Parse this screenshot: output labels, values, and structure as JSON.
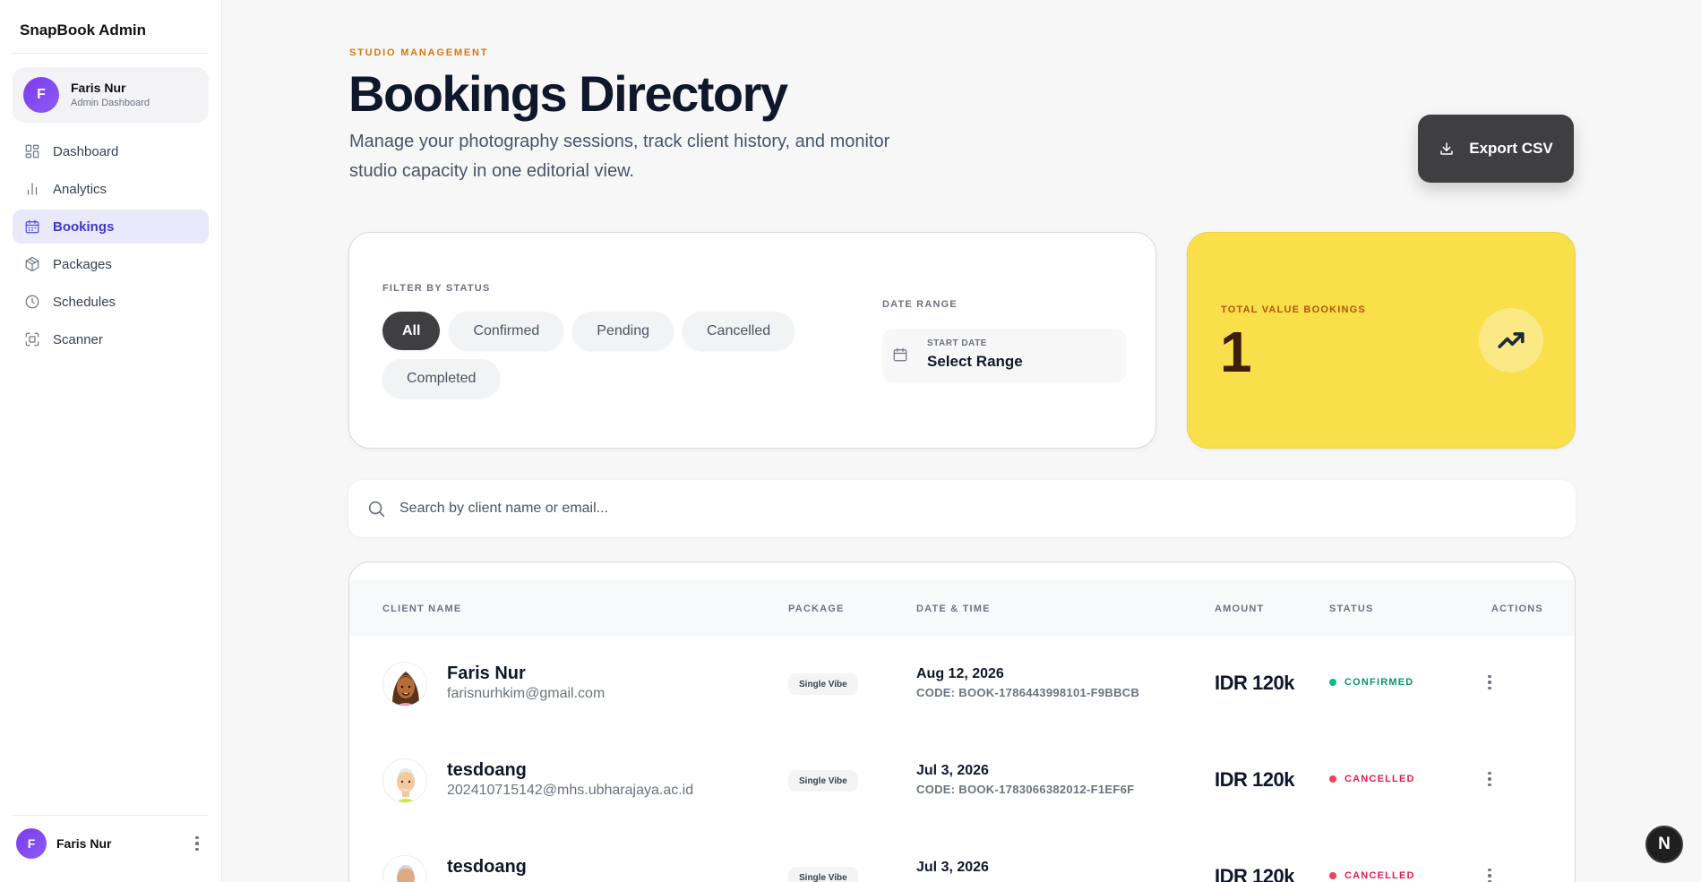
{
  "sidebar": {
    "brand": "SnapBook Admin",
    "user": {
      "initial": "F",
      "name": "Faris Nur",
      "role": "Admin Dashboard"
    },
    "items": [
      {
        "label": "Dashboard",
        "icon": "dashboard-icon"
      },
      {
        "label": "Analytics",
        "icon": "bar-chart-icon"
      },
      {
        "label": "Bookings",
        "icon": "calendar-icon",
        "active": true
      },
      {
        "label": "Packages",
        "icon": "package-icon"
      },
      {
        "label": "Schedules",
        "icon": "clock-icon"
      },
      {
        "label": "Scanner",
        "icon": "scan-icon"
      }
    ],
    "footer": {
      "initial": "F",
      "name": "Faris Nur"
    }
  },
  "header": {
    "eyebrow": "STUDIO MANAGEMENT",
    "title": "Bookings Directory",
    "subtitle": "Manage your photography sessions, track client history, and monitor studio capacity in one editorial view.",
    "export_label": "Export CSV"
  },
  "filters": {
    "status_label": "FILTER BY STATUS",
    "chips": [
      "All",
      "Confirmed",
      "Pending",
      "Cancelled",
      "Completed"
    ],
    "active_chip": "All",
    "date_range_label": "DATE RANGE",
    "start_date_label": "START DATE",
    "start_date_value": "Select Range"
  },
  "stat": {
    "label": "TOTAL VALUE BOOKINGS",
    "value": "1"
  },
  "search": {
    "placeholder": "Search by client name or email..."
  },
  "table": {
    "headers": {
      "client": "CLIENT NAME",
      "package": "PACKAGE",
      "datetime": "DATE & TIME",
      "amount": "AMOUNT",
      "status": "STATUS",
      "actions": "ACTIONS"
    },
    "rows": [
      {
        "name": "Faris Nur",
        "email": "farisnurhkim@gmail.com",
        "package": "Single Vibe",
        "date": "Aug 12, 2026",
        "code": "CODE: BOOK-1786443998101-F9BBCB",
        "amount": "IDR 120k",
        "status": "CONFIRMED",
        "status_color": "#10b981",
        "avatar": "female-avatar"
      },
      {
        "name": "tesdoang",
        "email": "202410715142@mhs.ubharajaya.ac.id",
        "package": "Single Vibe",
        "date": "Jul 3, 2026",
        "code": "CODE: BOOK-1783066382012-F1EF6F",
        "amount": "IDR 120k",
        "status": "CANCELLED",
        "status_color": "#f43f5e",
        "avatar": "elder-avatar"
      },
      {
        "name": "tesdoang",
        "email": "",
        "package": "Single Vibe",
        "date": "Jul 3, 2026",
        "code": "",
        "amount": "IDR 120k",
        "status": "CANCELLED",
        "status_color": "#f43f5e",
        "avatar": "elder-avatar"
      }
    ]
  },
  "fab": {
    "label": "N"
  },
  "colors": {
    "accent": "#4f46e5",
    "stat_bg": "#f9df4a",
    "eyebrow": "#d97706",
    "dark_button": "#3f3f42"
  }
}
